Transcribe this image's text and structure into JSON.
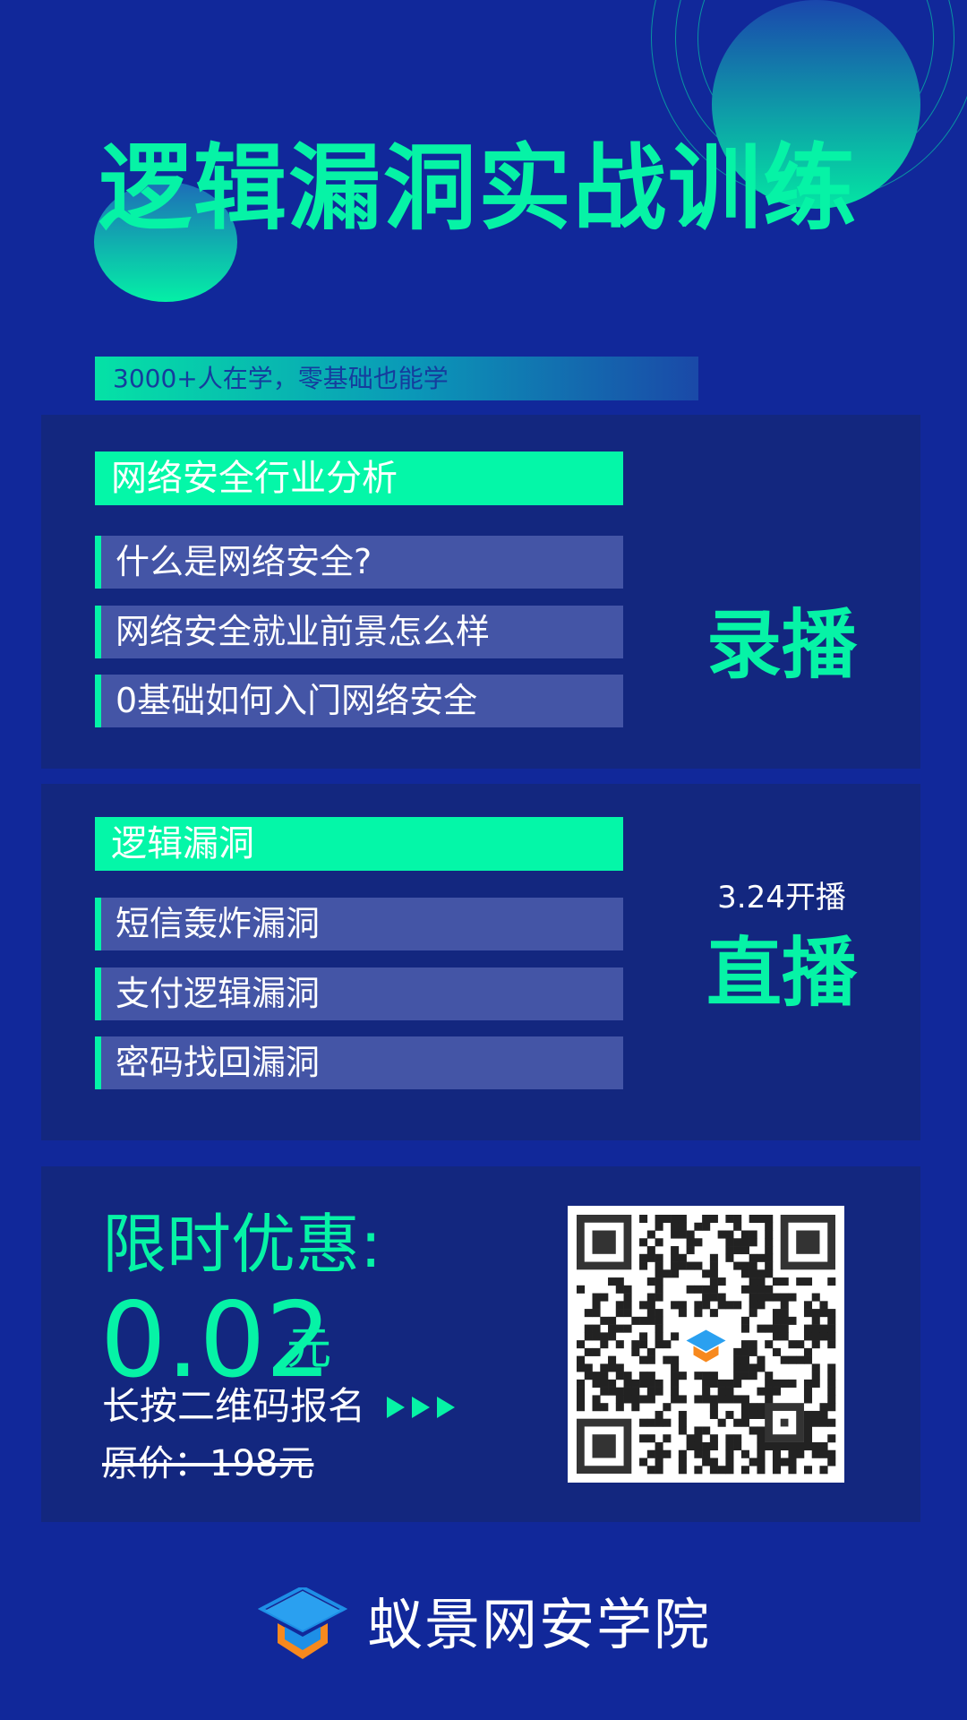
{
  "header": {
    "title": "逻辑漏洞实战训练",
    "tagline": "3000+人在学，零基础也能学"
  },
  "section_recorded": {
    "heading": "网络安全行业分析",
    "items": [
      "什么是网络安全?",
      "网络安全就业前景怎么样",
      "0基础如何入门网络安全"
    ],
    "badge": "录播"
  },
  "section_live": {
    "heading": "逻辑漏洞",
    "items": [
      "短信轰炸漏洞",
      "支付逻辑漏洞",
      "密码找回漏洞"
    ],
    "date": "3.24开播",
    "badge": "直播"
  },
  "promo": {
    "title": "限时优惠:",
    "price": "0.02",
    "price_unit": "元",
    "cta": "长按二维码报名",
    "original_price": "原价：198元",
    "qr_icon": "qr-code-icon"
  },
  "brand": {
    "name": "蚁景网安学院",
    "logo": "graduation-cap-icon"
  },
  "colors": {
    "background": "#11289a",
    "accent": "#06f3a6",
    "card": "#13277f",
    "item": "#4455a6",
    "logo_orange": "#f7891e",
    "logo_blue": "#1e8fe6"
  }
}
